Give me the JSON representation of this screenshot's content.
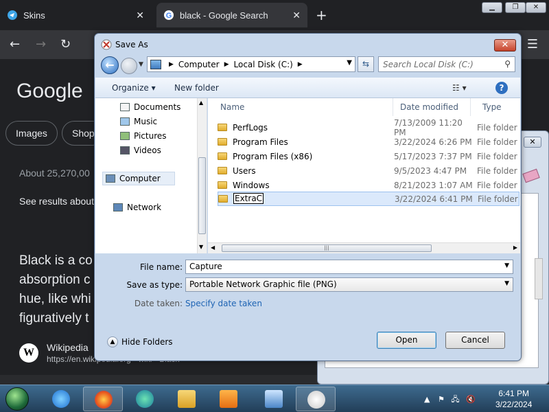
{
  "browser": {
    "tabs": [
      {
        "label": "Skins"
      },
      {
        "label": "black - Google Search"
      }
    ]
  },
  "google": {
    "logo": "Google",
    "chips": [
      "Images",
      "Shop"
    ],
    "about": "About 25,270,00",
    "see_results": "See results about",
    "description_lines": [
      "Black is a co",
      "absorption c",
      "hue, like whi",
      "figuratively t"
    ],
    "wiki_name": "Wikipedia",
    "wiki_url": "https://en.wikipedia.org › wiki › Black"
  },
  "dialog": {
    "title": "Save As",
    "close": "✕",
    "address": [
      "Computer",
      "Local Disk (C:)"
    ],
    "search_placeholder": "Search Local Disk (C:)",
    "organize": "Organize",
    "new_folder": "New folder",
    "nav": {
      "items": [
        "Documents",
        "Music",
        "Pictures",
        "Videos",
        "Computer",
        "Network"
      ]
    },
    "columns": [
      "Name",
      "Date modified",
      "Type"
    ],
    "files": [
      {
        "name": "PerfLogs",
        "date": "7/13/2009 11:20 PM",
        "type": "File folder"
      },
      {
        "name": "Program Files",
        "date": "3/22/2024 6:26 PM",
        "type": "File folder"
      },
      {
        "name": "Program Files (x86)",
        "date": "5/17/2023 7:37 PM",
        "type": "File folder"
      },
      {
        "name": "Users",
        "date": "9/5/2023 4:47 PM",
        "type": "File folder"
      },
      {
        "name": "Windows",
        "date": "8/21/2023 1:07 AM",
        "type": "File folder"
      },
      {
        "name": "ExtraC",
        "date": "3/22/2024 6:41 PM",
        "type": "File folder"
      }
    ],
    "file_name_label": "File name:",
    "file_name_value": "Capture",
    "save_as_type_label": "Save as type:",
    "save_as_type_value": "Portable Network Graphic file (PNG)",
    "date_taken_label": "Date taken:",
    "date_taken_link": "Specify date taken",
    "hide_folders": "Hide Folders",
    "open_button": "Open",
    "cancel_button": "Cancel"
  },
  "taskbar": {
    "time": "6:41 PM",
    "date": "3/22/2024"
  }
}
